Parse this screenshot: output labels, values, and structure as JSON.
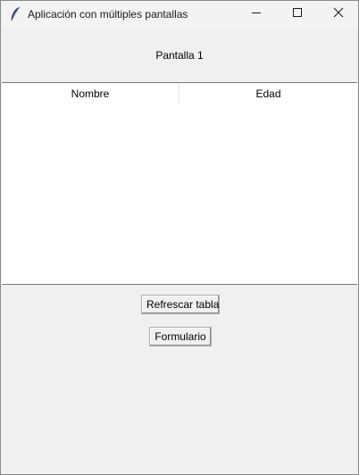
{
  "window": {
    "title": "Aplicación con múltiples pantallas",
    "icon": "feather-icon",
    "controls": [
      "minimize-icon",
      "maximize-icon",
      "close-icon"
    ]
  },
  "screen": {
    "label": "Pantalla 1"
  },
  "table": {
    "columns": [
      "Nombre",
      "Edad"
    ],
    "rows": []
  },
  "buttons": {
    "refresh_label": "Refrescar tabla",
    "form_label": "Formulario"
  }
}
